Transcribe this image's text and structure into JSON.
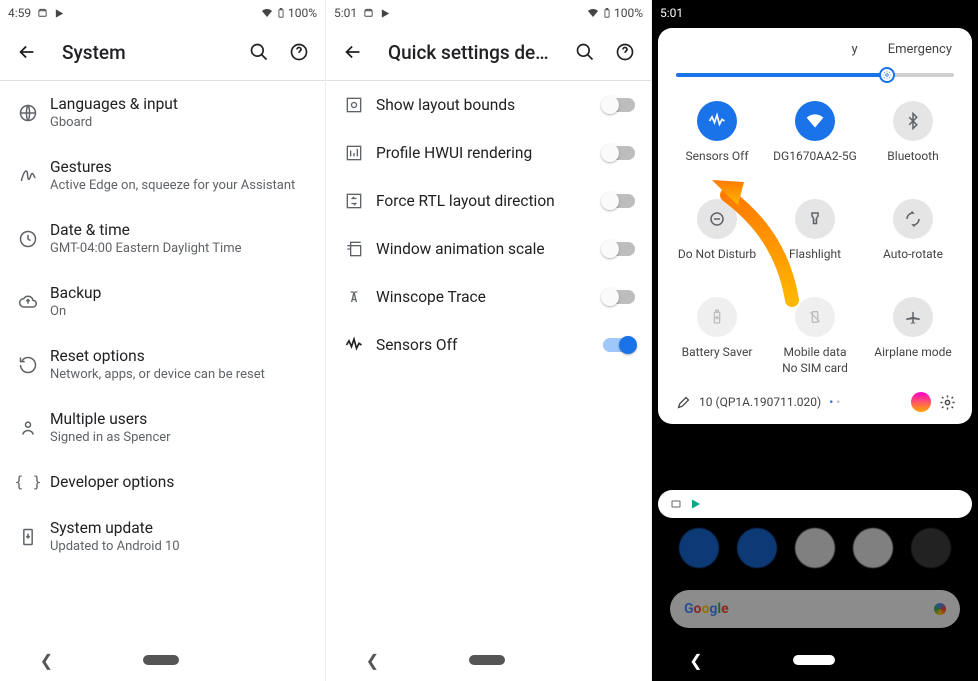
{
  "panel1": {
    "status": {
      "time": "4:59",
      "battery": "100%"
    },
    "title": "System",
    "items": [
      {
        "icon": "globe",
        "label": "Languages & input",
        "sub": "Gboard"
      },
      {
        "icon": "gesture",
        "label": "Gestures",
        "sub": "Active Edge on, squeeze for your Assistant"
      },
      {
        "icon": "clock",
        "label": "Date & time",
        "sub": "GMT-04:00 Eastern Daylight Time"
      },
      {
        "icon": "cloud",
        "label": "Backup",
        "sub": "On"
      },
      {
        "icon": "reset",
        "label": "Reset options",
        "sub": "Network, apps, or device can be reset"
      },
      {
        "icon": "user",
        "label": "Multiple users",
        "sub": "Signed in as Spencer"
      },
      {
        "icon": "braces",
        "label": "Developer options",
        "sub": ""
      },
      {
        "icon": "update",
        "label": "System update",
        "sub": "Updated to Android 10"
      }
    ]
  },
  "panel2": {
    "status": {
      "time": "5:01",
      "battery": "100%"
    },
    "title": "Quick settings develop…",
    "items": [
      {
        "icon": "bounds",
        "label": "Show layout bounds",
        "toggle": "off"
      },
      {
        "icon": "profile",
        "label": "Profile HWUI rendering",
        "toggle": "off"
      },
      {
        "icon": "rtl",
        "label": "Force RTL layout direction",
        "toggle": "off"
      },
      {
        "icon": "window",
        "label": "Window animation scale",
        "toggle": "off"
      },
      {
        "icon": "trace",
        "label": "Winscope Trace",
        "toggle": "off"
      },
      {
        "icon": "sensors",
        "label": "Sensors Off",
        "toggle": "on"
      }
    ]
  },
  "panel3": {
    "status": {
      "time": "5:01"
    },
    "header": {
      "short": "y",
      "emergency": "Emergency"
    },
    "build": "10 (QP1A.190711.020)",
    "tiles": [
      {
        "name": "sensors",
        "label": "Sensors Off",
        "state": "on"
      },
      {
        "name": "wifi",
        "label": "DG1670AA2-5G",
        "state": "on"
      },
      {
        "name": "bt",
        "label": "Bluetooth",
        "state": "off"
      },
      {
        "name": "dnd",
        "label": "Do Not Disturb",
        "state": "off"
      },
      {
        "name": "flash",
        "label": "Flashlight",
        "state": "off"
      },
      {
        "name": "rotate",
        "label": "Auto-rotate",
        "state": "off"
      },
      {
        "name": "battery",
        "label": "Battery Saver",
        "state": "dis"
      },
      {
        "name": "mobile",
        "label": "Mobile data\nNo SIM card",
        "state": "dis"
      },
      {
        "name": "airplane",
        "label": "Airplane mode",
        "state": "off"
      }
    ]
  }
}
